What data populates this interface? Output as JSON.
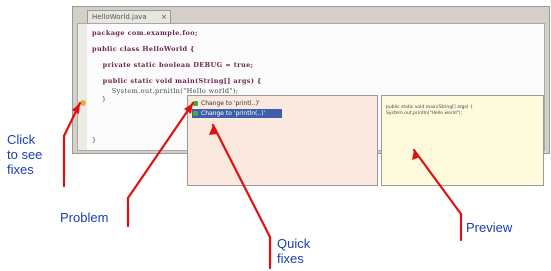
{
  "editor": {
    "tab_label": "HelloWorld.java",
    "tab_close": "×",
    "code_lines": [
      "package com.example.foo;",
      "public class HelloWorld {",
      "    private static boolean DEBUG = true;",
      "    public static void main(String[] args) {",
      "        System.out.prnitln(\"Hello world\");",
      "    }",
      "}"
    ]
  },
  "quick_fixes": {
    "items": [
      {
        "label": "Change to 'print(..)'"
      },
      {
        "label": "Change to 'println(..)'"
      }
    ],
    "selected_index": 1
  },
  "preview": {
    "lines": [
      "public static void main(String[] args) {",
      "    System.out.println(\"Hello world\");"
    ]
  },
  "annotations": {
    "click_to_see_fixes": [
      "Click",
      "to see",
      "fixes"
    ],
    "problem": "Problem",
    "quick_fixes": [
      "Quick",
      "fixes"
    ],
    "preview": "Preview"
  },
  "colors": {
    "annotation_text": "#1a3fb0",
    "arrow": "#e01010",
    "fixes_bg": "#fbe8de",
    "preview_bg": "#fdfbdc",
    "selection": "#3d5ea8"
  }
}
